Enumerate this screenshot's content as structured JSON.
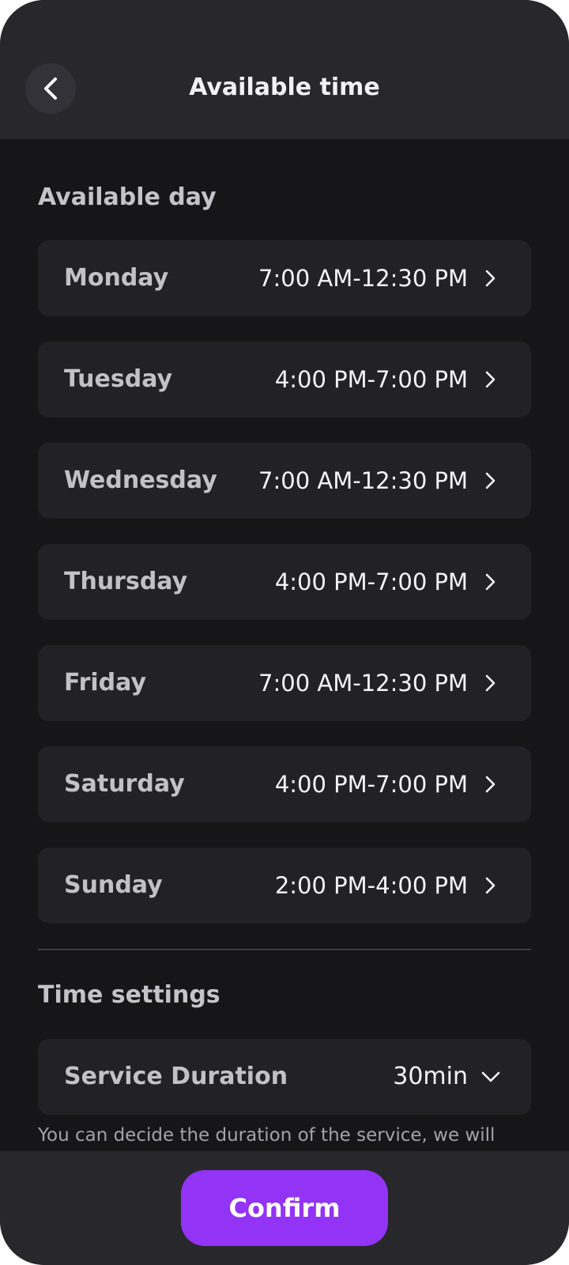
{
  "header": {
    "title": "Available time",
    "back_icon": "chevron-left-icon"
  },
  "available_day": {
    "section_title": "Available day",
    "days": [
      {
        "day": "Monday",
        "time": "7:00 AM-12:30 PM"
      },
      {
        "day": "Tuesday",
        "time": "4:00 PM-7:00 PM"
      },
      {
        "day": "Wednesday",
        "time": "7:00 AM-12:30 PM"
      },
      {
        "day": "Thursday",
        "time": "4:00 PM-7:00 PM"
      },
      {
        "day": "Friday",
        "time": "7:00 AM-12:30 PM"
      },
      {
        "day": "Saturday",
        "time": "4:00 PM-7:00 PM"
      },
      {
        "day": "Sunday",
        "time": "2:00 PM-4:00 PM"
      }
    ],
    "row_icon": "chevron-right-icon"
  },
  "time_settings": {
    "section_title": "Time settings",
    "service_duration": {
      "label": "Service Duration",
      "value": "30min",
      "icon": "chevron-down-icon"
    },
    "helper_text": "You can decide the duration of the service, we will"
  },
  "footer": {
    "confirm_label": "Confirm"
  },
  "colors": {
    "background": "#161618",
    "header_background": "#28272c",
    "card_background": "#222125",
    "accent": "#9233f5"
  }
}
